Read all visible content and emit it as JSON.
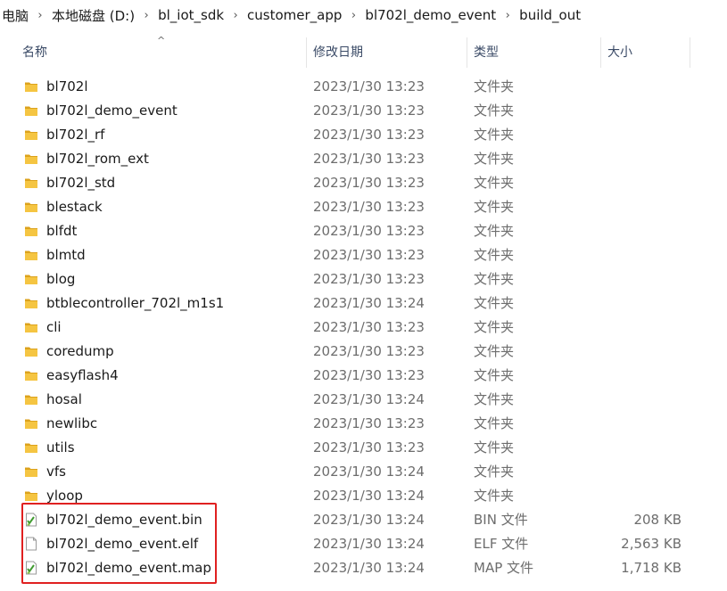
{
  "breadcrumb": [
    "电脑",
    "本地磁盘 (D:)",
    "bl_iot_sdk",
    "customer_app",
    "bl702l_demo_event",
    "build_out"
  ],
  "columns": {
    "name": "名称",
    "date": "修改日期",
    "type": "类型",
    "size": "大小"
  },
  "files": [
    {
      "name": "bl702l",
      "date": "2023/1/30 13:23",
      "type": "文件夹",
      "size": "",
      "icon": "folder-icon"
    },
    {
      "name": "bl702l_demo_event",
      "date": "2023/1/30 13:23",
      "type": "文件夹",
      "size": "",
      "icon": "folder-icon"
    },
    {
      "name": "bl702l_rf",
      "date": "2023/1/30 13:23",
      "type": "文件夹",
      "size": "",
      "icon": "folder-icon"
    },
    {
      "name": "bl702l_rom_ext",
      "date": "2023/1/30 13:23",
      "type": "文件夹",
      "size": "",
      "icon": "folder-icon"
    },
    {
      "name": "bl702l_std",
      "date": "2023/1/30 13:23",
      "type": "文件夹",
      "size": "",
      "icon": "folder-icon"
    },
    {
      "name": "blestack",
      "date": "2023/1/30 13:23",
      "type": "文件夹",
      "size": "",
      "icon": "folder-icon"
    },
    {
      "name": "blfdt",
      "date": "2023/1/30 13:23",
      "type": "文件夹",
      "size": "",
      "icon": "folder-icon"
    },
    {
      "name": "blmtd",
      "date": "2023/1/30 13:23",
      "type": "文件夹",
      "size": "",
      "icon": "folder-icon"
    },
    {
      "name": "blog",
      "date": "2023/1/30 13:23",
      "type": "文件夹",
      "size": "",
      "icon": "folder-icon"
    },
    {
      "name": "btblecontroller_702l_m1s1",
      "date": "2023/1/30 13:24",
      "type": "文件夹",
      "size": "",
      "icon": "folder-icon"
    },
    {
      "name": "cli",
      "date": "2023/1/30 13:23",
      "type": "文件夹",
      "size": "",
      "icon": "folder-icon"
    },
    {
      "name": "coredump",
      "date": "2023/1/30 13:23",
      "type": "文件夹",
      "size": "",
      "icon": "folder-icon"
    },
    {
      "name": "easyflash4",
      "date": "2023/1/30 13:23",
      "type": "文件夹",
      "size": "",
      "icon": "folder-icon"
    },
    {
      "name": "hosal",
      "date": "2023/1/30 13:24",
      "type": "文件夹",
      "size": "",
      "icon": "folder-icon"
    },
    {
      "name": "newlibc",
      "date": "2023/1/30 13:23",
      "type": "文件夹",
      "size": "",
      "icon": "folder-icon"
    },
    {
      "name": "utils",
      "date": "2023/1/30 13:23",
      "type": "文件夹",
      "size": "",
      "icon": "folder-icon"
    },
    {
      "name": "vfs",
      "date": "2023/1/30 13:24",
      "type": "文件夹",
      "size": "",
      "icon": "folder-icon"
    },
    {
      "name": "yloop",
      "date": "2023/1/30 13:24",
      "type": "文件夹",
      "size": "",
      "icon": "folder-icon"
    },
    {
      "name": "bl702l_demo_event.bin",
      "date": "2023/1/30 13:24",
      "type": "BIN 文件",
      "size": "208 KB",
      "icon": "notepadpp-file-icon"
    },
    {
      "name": "bl702l_demo_event.elf",
      "date": "2023/1/30 13:24",
      "type": "ELF 文件",
      "size": "2,563 KB",
      "icon": "blank-file-icon"
    },
    {
      "name": "bl702l_demo_event.map",
      "date": "2023/1/30 13:24",
      "type": "MAP 文件",
      "size": "1,718 KB",
      "icon": "notepadpp-file-icon"
    }
  ],
  "colors": {
    "folder": "#f5c542",
    "folder_dark": "#dca21c",
    "highlight": "#e02020",
    "header_text": "#3a4a66",
    "meta_text": "#6d6d6d"
  }
}
